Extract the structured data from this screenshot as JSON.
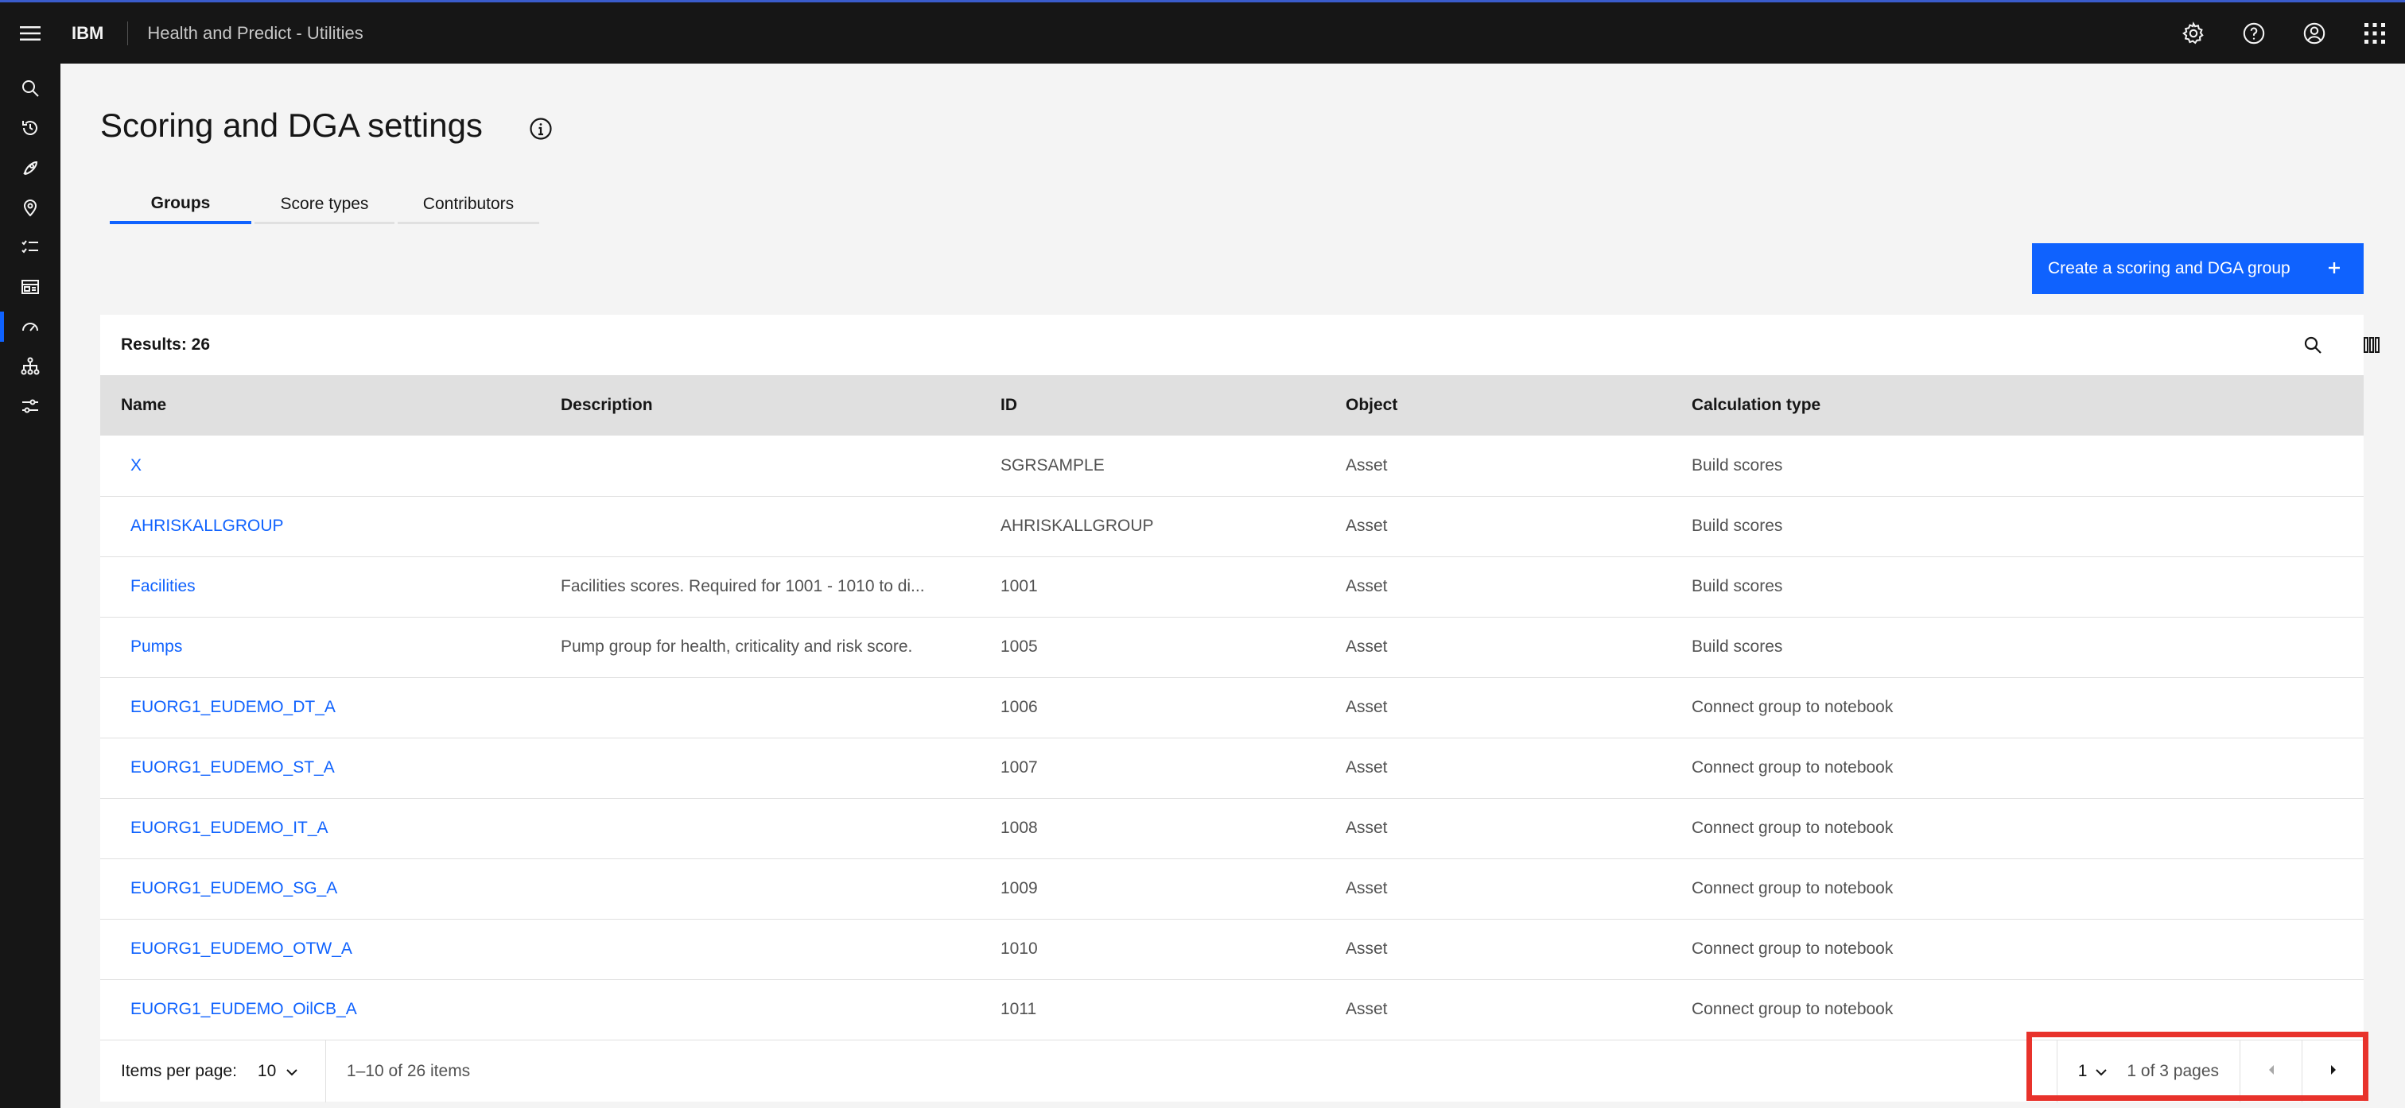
{
  "header": {
    "brand": "IBM",
    "app_name": "Health and Predict - Utilities",
    "actions": [
      {
        "icon": "settings-icon"
      },
      {
        "icon": "help-icon"
      },
      {
        "icon": "user-avatar-icon"
      },
      {
        "icon": "app-switcher-icon"
      }
    ]
  },
  "sidenav": {
    "items": [
      {
        "icon": "search-icon"
      },
      {
        "icon": "recent-icon"
      },
      {
        "icon": "rocket-icon"
      },
      {
        "icon": "location-icon"
      },
      {
        "icon": "task-list-icon"
      },
      {
        "icon": "dashboard-icon"
      },
      {
        "icon": "gauge-icon",
        "active": true
      },
      {
        "icon": "hierarchy-icon"
      },
      {
        "icon": "sliders-icon"
      }
    ]
  },
  "page": {
    "title": "Scoring and DGA settings"
  },
  "tabs": [
    {
      "label": "Groups",
      "active": true
    },
    {
      "label": "Score types"
    },
    {
      "label": "Contributors"
    }
  ],
  "create_button": {
    "label": "Create a scoring and DGA group"
  },
  "table": {
    "results_label": "Results: 26",
    "columns": [
      "Name",
      "Description",
      "ID",
      "Object",
      "Calculation type"
    ],
    "rows": [
      {
        "name": "X",
        "description": "",
        "id": "SGRSAMPLE",
        "object": "Asset",
        "calc": "Build scores"
      },
      {
        "name": "AHRISKALLGROUP",
        "description": "",
        "id": "AHRISKALLGROUP",
        "object": "Asset",
        "calc": "Build scores"
      },
      {
        "name": "Facilities",
        "description": "Facilities scores. Required for 1001 - 1010 to di...",
        "id": "1001",
        "object": "Asset",
        "calc": "Build scores"
      },
      {
        "name": "Pumps",
        "description": "Pump group for health, criticality and risk score.",
        "id": "1005",
        "object": "Asset",
        "calc": "Build scores"
      },
      {
        "name": "EUORG1_EUDEMO_DT_A",
        "description": "",
        "id": "1006",
        "object": "Asset",
        "calc": "Connect group to notebook"
      },
      {
        "name": "EUORG1_EUDEMO_ST_A",
        "description": "",
        "id": "1007",
        "object": "Asset",
        "calc": "Connect group to notebook"
      },
      {
        "name": "EUORG1_EUDEMO_IT_A",
        "description": "",
        "id": "1008",
        "object": "Asset",
        "calc": "Connect group to notebook"
      },
      {
        "name": "EUORG1_EUDEMO_SG_A",
        "description": "",
        "id": "1009",
        "object": "Asset",
        "calc": "Connect group to notebook"
      },
      {
        "name": "EUORG1_EUDEMO_OTW_A",
        "description": "",
        "id": "1010",
        "object": "Asset",
        "calc": "Connect group to notebook"
      },
      {
        "name": "EUORG1_EUDEMO_OilCB_A",
        "description": "",
        "id": "1011",
        "object": "Asset",
        "calc": "Connect group to notebook"
      }
    ]
  },
  "pagination": {
    "items_per_page_label": "Items per page:",
    "items_per_page": "10",
    "range": "1–10 of 26 items",
    "current_page": "1",
    "page_of": "1 of 3 pages"
  },
  "colors": {
    "accent": "#0f62fe",
    "header_bg": "#161616",
    "highlight": "#e8322b"
  }
}
